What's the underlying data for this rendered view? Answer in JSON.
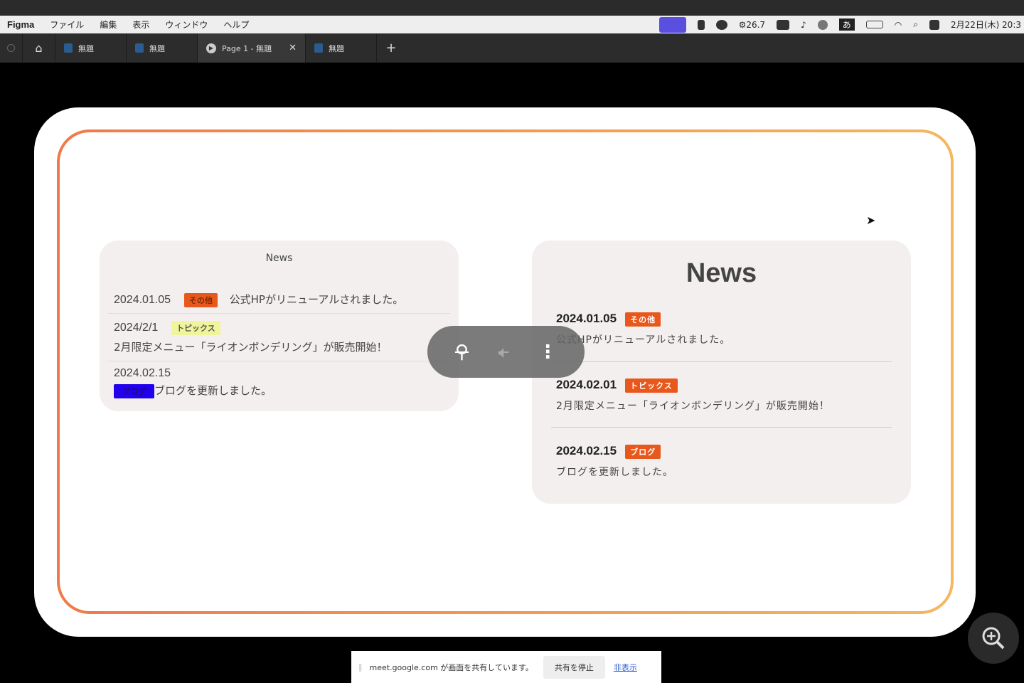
{
  "menubar": {
    "app": "Figma",
    "items": [
      "ファイル",
      "編集",
      "表示",
      "ウィンドウ",
      "ヘルプ"
    ],
    "battery_text": "26.7",
    "datetime": "2月22日(木) 20:3",
    "ime": "あ"
  },
  "tabs": [
    {
      "label": "無題"
    },
    {
      "label": "無題"
    },
    {
      "label": "Page 1 - 無題",
      "active": true
    },
    {
      "label": "無題"
    }
  ],
  "cardLeft": {
    "title": "News",
    "items": [
      {
        "date": "2024.01.05",
        "tag": "その他",
        "tag_bg": "#e8581c",
        "tag_color": "#7a2a00",
        "text": "公式HPがリニューアルされました。"
      },
      {
        "date": "2024/2/1",
        "tag": "トピックス",
        "tag_bg": "#eef59a",
        "tag_color": "#555",
        "text": "2月限定メニュー「ライオンボンデリング」が販売開始！"
      },
      {
        "date": "2024.02.15",
        "tag": "ブログ",
        "tag_bg": "#2200ee",
        "tag_color": "#1a1070",
        "text": "ブログを更新しました。"
      }
    ]
  },
  "cardRight": {
    "title": "News",
    "items": [
      {
        "date": "2024.01.05",
        "tag": "その他",
        "text": "公式HPがリニューアルされました。"
      },
      {
        "date": "2024.02.01",
        "tag": "トピックス",
        "text": "2月限定メニュー「ライオンボンデリング」が販売開始！"
      },
      {
        "date": "2024.02.15",
        "tag": "ブログ",
        "text": "ブログを更新しました。"
      }
    ]
  },
  "sharebar": {
    "message": "meet.google.com が画面を共有しています。",
    "stop": "共有を停止",
    "hide": "非表示"
  },
  "colors": {
    "accent": "#e8581c",
    "frame_gradient": [
      "#f07a48",
      "#f5b760"
    ]
  }
}
